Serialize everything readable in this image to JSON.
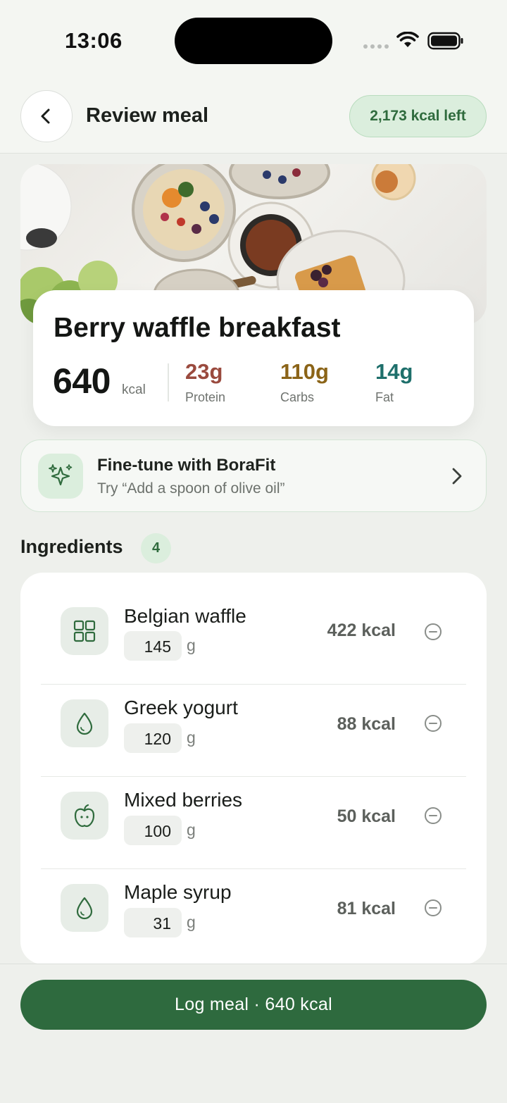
{
  "status_bar": {
    "time": "13:06"
  },
  "header": {
    "title": "Review meal",
    "kcal_left": "2,173 kcal left"
  },
  "meal": {
    "name": "Berry waffle breakfast",
    "kcal": "640",
    "kcal_unit": "kcal",
    "macros": {
      "protein": {
        "value": "23g",
        "label": "Protein",
        "color": "#9a4a3e"
      },
      "carbs": {
        "value": "110g",
        "label": "Carbs",
        "color": "#8b6418"
      },
      "fat": {
        "value": "14g",
        "label": "Fat",
        "color": "#1e6f6b"
      }
    }
  },
  "finetune": {
    "title": "Fine-tune with BoraFit",
    "subtitle": "Try “Add a spoon of olive oil”",
    "icon": "sparkles-icon"
  },
  "ingredients": {
    "title": "Ingredients",
    "count": "4",
    "items": [
      {
        "name": "Belgian waffle",
        "qty": "145",
        "unit": "g",
        "kcal": "422 kcal",
        "icon": "grid-icon"
      },
      {
        "name": "Greek yogurt",
        "qty": "120",
        "unit": "g",
        "kcal": "88 kcal",
        "icon": "droplet-icon"
      },
      {
        "name": "Mixed berries",
        "qty": "100",
        "unit": "g",
        "kcal": "50 kcal",
        "icon": "apple-icon"
      },
      {
        "name": "Maple syrup",
        "qty": "31",
        "unit": "g",
        "kcal": "81 kcal",
        "icon": "droplet-icon"
      }
    ]
  },
  "footer": {
    "log_label": "Log meal · 640 kcal"
  },
  "colors": {
    "accent": "#2e6a3e",
    "accent_soft": "#dbeedd",
    "background": "#eef0ec"
  }
}
